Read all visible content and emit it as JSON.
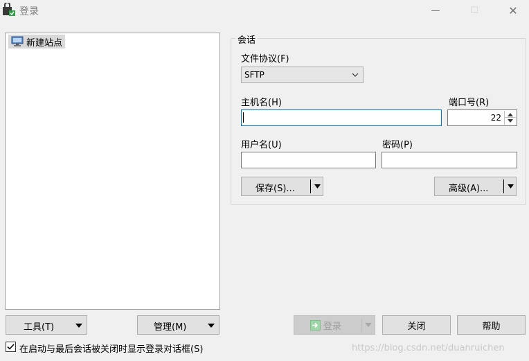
{
  "window": {
    "title": "登录",
    "minimize_glyph": "—",
    "maximize_glyph": "☐",
    "close_glyph": "✕"
  },
  "site_tree": {
    "items": [
      {
        "label": "新建站点",
        "icon": "computer-icon"
      }
    ]
  },
  "session": {
    "group_label": "会话",
    "protocol": {
      "label": "文件协议(F)",
      "value": "SFTP"
    },
    "hostname": {
      "label": "主机名(H)",
      "value": ""
    },
    "port": {
      "label": "端口号(R)",
      "value": "22"
    },
    "username": {
      "label": "用户名(U)",
      "value": ""
    },
    "password": {
      "label": "密码(P)",
      "value": ""
    },
    "save_button": "保存(S)...",
    "advanced_button": "高级(A)..."
  },
  "bottom": {
    "tools_button": "工具(T)",
    "manage_button": "管理(M)",
    "login_button": "登录",
    "close_button": "关闭",
    "help_button": "帮助",
    "show_dialog_checkbox": {
      "label": "在启动与最后会话被关闭时显示登录对话框(S)",
      "checked": true
    }
  },
  "watermark": "https://blog.csdn.net/duanruichen",
  "colors": {
    "focus_border": "#0078d7",
    "button_face": "#e1e1e1",
    "window_bg": "#f0f0f0"
  }
}
